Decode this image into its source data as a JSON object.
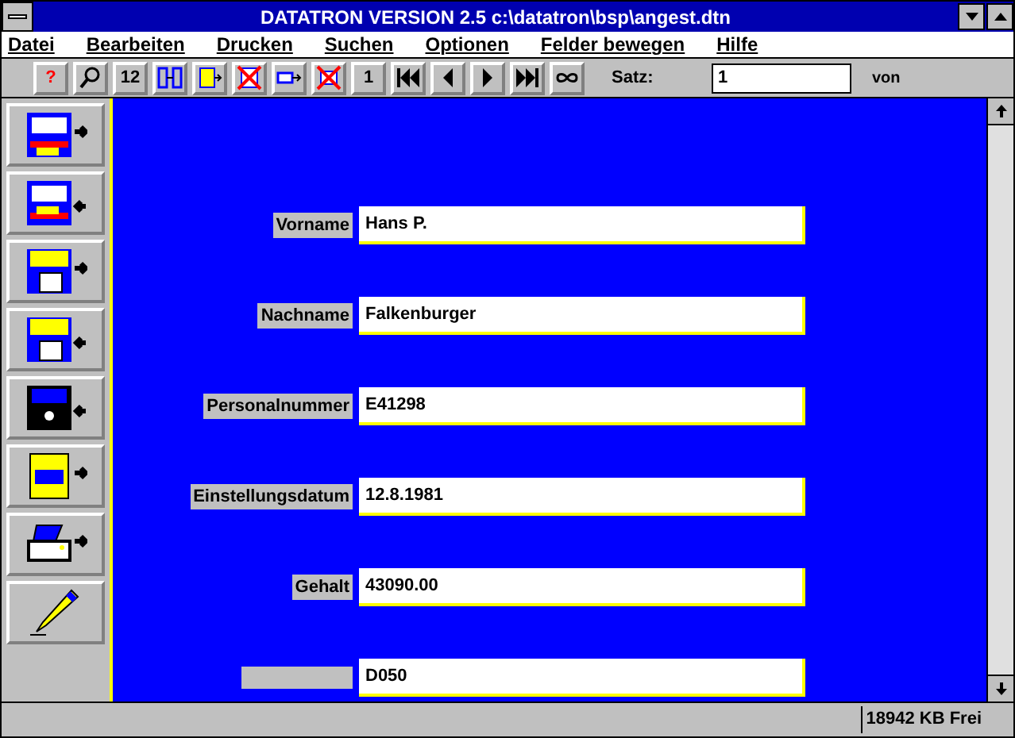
{
  "window": {
    "title": "DATATRON VERSION 2.5 c:\\datatron\\bsp\\angest.dtn"
  },
  "menu": [
    "Datei",
    "Bearbeiten",
    "Drucken",
    "Suchen",
    "Optionen",
    "Felder bewegen",
    "Hilfe"
  ],
  "toolbar": [
    {
      "kind": "text",
      "label": "?"
    },
    {
      "kind": "icon"
    },
    {
      "kind": "text",
      "label": "12"
    },
    {
      "kind": "icon"
    },
    {
      "kind": "icon"
    },
    {
      "kind": "icon"
    },
    {
      "kind": "icon"
    },
    {
      "kind": "icon"
    },
    {
      "kind": "text",
      "label": "1"
    },
    {
      "kind": "icon"
    },
    {
      "kind": "icon"
    },
    {
      "kind": "icon"
    },
    {
      "kind": "icon"
    },
    {
      "kind": "icon"
    }
  ],
  "record": {
    "label": "Satz:",
    "value": "1",
    "of_label": "von"
  },
  "fields": [
    {
      "label": "Vorname",
      "value": "Hans P."
    },
    {
      "label": "Nachname",
      "value": "Falkenburger"
    },
    {
      "label": "Personalnummer",
      "value": "E41298"
    },
    {
      "label": "Einstellungsdatum",
      "value": "12.8.1981"
    },
    {
      "label": "Gehalt",
      "value": "43090.00"
    },
    {
      "value": "D050"
    }
  ],
  "status_bar": {
    "memory": "18942 KB Frei"
  }
}
